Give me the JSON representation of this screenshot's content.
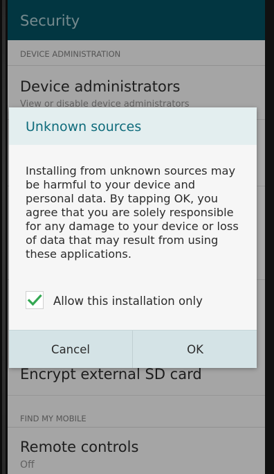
{
  "appbar": {
    "title": "Security"
  },
  "sections": {
    "device_admin_header": "DEVICE ADMINISTRATION",
    "find_my_mobile_header": "FIND MY MOBILE"
  },
  "items": {
    "device_administrators": {
      "title": "Device administrators",
      "subtitle": "View or disable device administrators"
    },
    "encrypt_sd": {
      "title": "Encrypt external SD card"
    },
    "remote_controls": {
      "title": "Remote controls",
      "subtitle": "Off"
    }
  },
  "dialog": {
    "title": "Unknown sources",
    "message": "Installing from unknown sources may be harmful to your device and personal data. By tapping OK, you agree that you are solely responsible for any damage to your device or loss of data that may result from using these applications.",
    "checkbox_label": "Allow this installation only",
    "checkbox_checked": true,
    "cancel_label": "Cancel",
    "ok_label": "OK"
  },
  "colors": {
    "appbar": "#034e5e",
    "dialog_title": "#0e6b7b",
    "check": "#34a853"
  }
}
